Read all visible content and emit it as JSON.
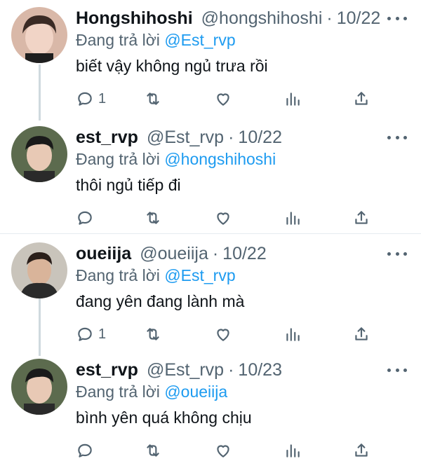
{
  "reply_prefix": "Đang trả lời",
  "tweets": [
    {
      "name": "Hongshihoshi",
      "handle": "@hongshihoshi",
      "date": "10/22",
      "reply_to": "@Est_rvp",
      "text": "biết vậy không ngủ trưa rồi",
      "reply_count": "1"
    },
    {
      "name": "est_rvp",
      "handle": "@Est_rvp",
      "date": "10/22",
      "reply_to": "@hongshihoshi",
      "text": "thôi ngủ tiếp đi",
      "reply_count": ""
    },
    {
      "name": "oueiija",
      "handle": "@oueiija",
      "date": "10/22",
      "reply_to": "@Est_rvp",
      "text": "đang yên đang lành mà",
      "reply_count": "1"
    },
    {
      "name": "est_rvp",
      "handle": "@Est_rvp",
      "date": "10/23",
      "reply_to": "@oueiija",
      "text": "bình yên quá không chịu",
      "reply_count": ""
    }
  ],
  "separator_glyph": "·",
  "colors": {
    "link": "#1d9bf0",
    "secondary": "#536471",
    "text": "#0f1419",
    "thread_line": "#cfd9de"
  },
  "icons": [
    "reply-icon",
    "retweet-icon",
    "like-icon",
    "stats-icon",
    "share-icon",
    "more-icon"
  ]
}
